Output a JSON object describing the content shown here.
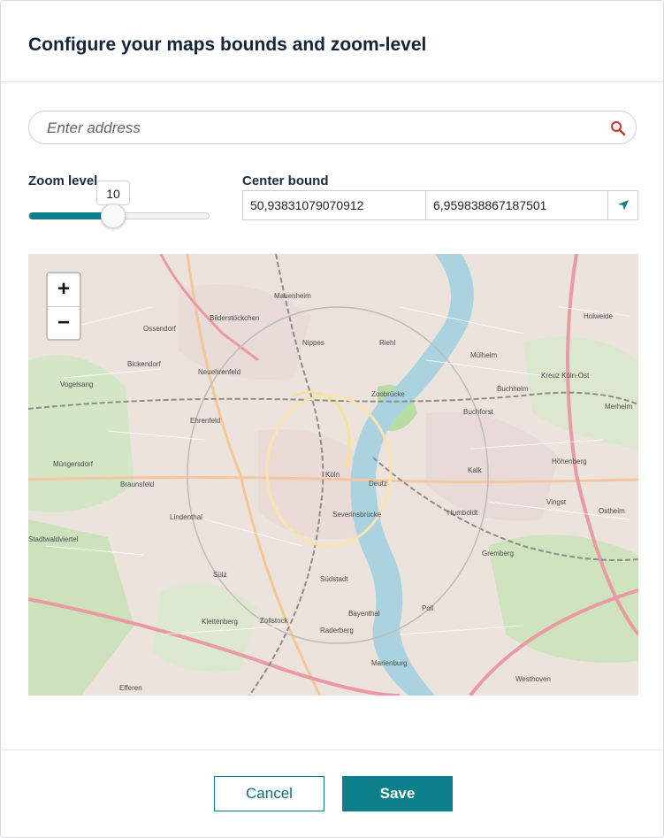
{
  "dialog": {
    "title": "Configure your maps bounds and zoom-level"
  },
  "search": {
    "placeholder": "Enter address",
    "icon": "search-icon"
  },
  "zoom": {
    "label": "Zoom level",
    "value": "10",
    "min": 0,
    "max": 18
  },
  "center": {
    "label": "Center bound",
    "lat": "50,93831079070912",
    "lng": "6,959838867187501",
    "icon": "location-arrow-icon"
  },
  "map": {
    "zoom_in": "+",
    "zoom_out": "−",
    "labels": [
      "Mauenheim",
      "Ossendorf",
      "Bilderstöckchen",
      "Nippes",
      "Riehl",
      "Bickendorf",
      "Neuehrenfeld",
      "Mülheim",
      "Vogelsang",
      "Buchheim",
      "Merheim",
      "Zoobrücke",
      "Ehrenfeld",
      "Buchforst",
      "Müngersdorf",
      "Kalk",
      "Höhenberg",
      "Braunsfeld",
      "Köln",
      "Deutz",
      "Lindenthal",
      "Humboldt",
      "Vingst",
      "Ostheim",
      "Stadtwaldviertel",
      "Gremberg",
      "Sülz",
      "Südstadt",
      "Poll",
      "Klettenberg",
      "Zollstock",
      "Bayenthal",
      "Raderberg",
      "Efferen",
      "Marienburg",
      "Westhoven",
      "Holweide",
      "Severinsbrücke",
      "Kreuz Köln-Ost"
    ]
  },
  "footer": {
    "cancel": "Cancel",
    "save": "Save"
  },
  "colors": {
    "accent": "#0d7f8a",
    "title": "#14253a",
    "search_icon": "#d0302f"
  }
}
